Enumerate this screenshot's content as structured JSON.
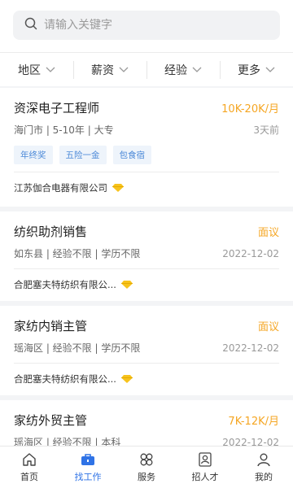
{
  "search": {
    "placeholder": "请输入关键字"
  },
  "filters": [
    {
      "label": "地区"
    },
    {
      "label": "薪资"
    },
    {
      "label": "经验"
    },
    {
      "label": "更多"
    }
  ],
  "jobs": [
    {
      "title": "资深电子工程师",
      "salary": "10K-20K/月",
      "meta": "海门市 | 5-10年 | 大专",
      "date": "3天前",
      "tags": [
        "年终奖",
        "五险一金",
        "包食宿"
      ],
      "company": "江苏伽合电器有限公司"
    },
    {
      "title": "纺织助剂销售",
      "salary": "面议",
      "meta": "如东县 | 经验不限 | 学历不限",
      "date": "2022-12-02",
      "company": "合肥塞夫特纺织有限公..."
    },
    {
      "title": "家纺内销主管",
      "salary": "面议",
      "meta": "瑶海区 | 经验不限 | 学历不限",
      "date": "2022-12-02",
      "company": "合肥塞夫特纺织有限公..."
    },
    {
      "title": "家纺外贸主管",
      "salary": "7K-12K/月",
      "meta": "瑶海区 | 经验不限 | 本科",
      "date": "2022-12-02"
    }
  ],
  "tabbar": [
    {
      "label": "首页",
      "icon": "home-icon"
    },
    {
      "label": "找工作",
      "icon": "briefcase-icon",
      "active": true
    },
    {
      "label": "服务",
      "icon": "services-icon"
    },
    {
      "label": "招人才",
      "icon": "recruit-icon"
    },
    {
      "label": "我的",
      "icon": "profile-icon"
    }
  ],
  "colors": {
    "accent": "#2f73e6",
    "salary": "#f5a623",
    "tag_text": "#4d8ad8",
    "tag_bg": "#eef4fb",
    "gem": "#f7c31c"
  }
}
